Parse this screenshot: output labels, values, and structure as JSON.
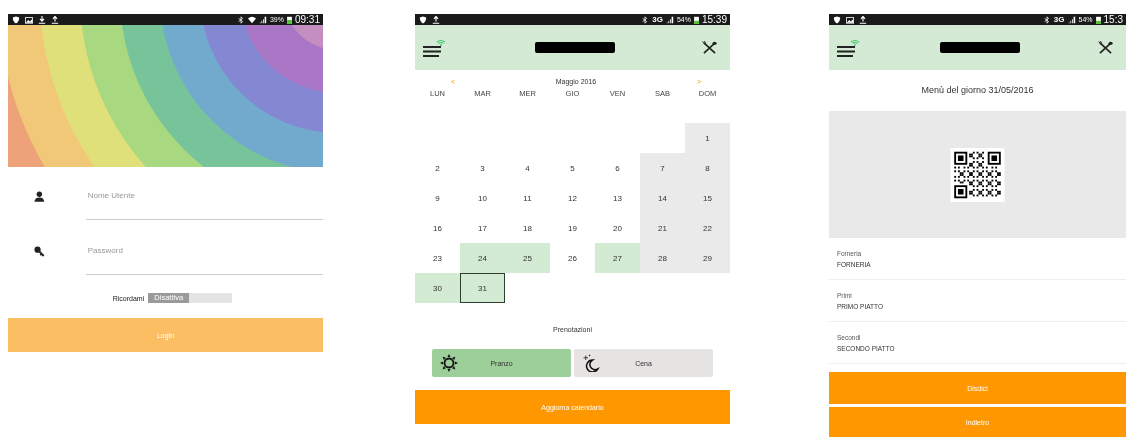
{
  "login_screen": {
    "status_bar": {
      "battery": "39%",
      "time": "09:31"
    },
    "username_field": {
      "placeholder": "Nome Utente"
    },
    "password_field": {
      "placeholder": "Password"
    },
    "remember": {
      "label": "Ricordami",
      "state_text": "Disattiva",
      "on": false
    },
    "login_button": "Login"
  },
  "calendar_screen": {
    "status_bar": {
      "network": "3G",
      "battery": "54%",
      "time": "15:39"
    },
    "prev": "<",
    "month": "Maggio 2016",
    "next": ">",
    "weekdays": [
      "LUN",
      "MAR",
      "MER",
      "GIO",
      "VEN",
      "SAB",
      "DOM"
    ],
    "days": [
      {
        "kind": "empty"
      },
      {
        "kind": "empty"
      },
      {
        "kind": "empty"
      },
      {
        "kind": "empty"
      },
      {
        "kind": "empty"
      },
      {
        "kind": "empty"
      },
      {
        "label": "1",
        "kind": "weekend",
        "selected": false
      },
      {
        "label": "2",
        "kind": "weekday",
        "selected": false
      },
      {
        "label": "3",
        "kind": "weekday",
        "selected": false
      },
      {
        "label": "4",
        "kind": "weekday",
        "selected": false
      },
      {
        "label": "5",
        "kind": "weekday",
        "selected": false
      },
      {
        "label": "6",
        "kind": "weekday",
        "selected": false
      },
      {
        "label": "7",
        "kind": "weekend",
        "selected": false
      },
      {
        "label": "8",
        "kind": "weekend",
        "selected": false
      },
      {
        "label": "9",
        "kind": "weekday",
        "selected": false
      },
      {
        "label": "10",
        "kind": "weekday",
        "selected": false
      },
      {
        "label": "11",
        "kind": "weekday",
        "selected": false
      },
      {
        "label": "12",
        "kind": "weekday",
        "selected": false
      },
      {
        "label": "13",
        "kind": "weekday",
        "selected": false
      },
      {
        "label": "14",
        "kind": "weekend",
        "selected": false
      },
      {
        "label": "15",
        "kind": "weekend",
        "selected": false
      },
      {
        "label": "16",
        "kind": "weekday",
        "selected": false
      },
      {
        "label": "17",
        "kind": "weekday",
        "selected": false
      },
      {
        "label": "18",
        "kind": "weekday",
        "selected": false
      },
      {
        "label": "19",
        "kind": "weekday",
        "selected": false
      },
      {
        "label": "20",
        "kind": "weekday",
        "selected": false
      },
      {
        "label": "21",
        "kind": "weekend",
        "selected": false
      },
      {
        "label": "22",
        "kind": "weekend",
        "selected": false
      },
      {
        "label": "23",
        "kind": "weekday",
        "selected": false
      },
      {
        "label": "24",
        "kind": "booked",
        "selected": false
      },
      {
        "label": "25",
        "kind": "booked",
        "selected": false
      },
      {
        "label": "26",
        "kind": "weekday",
        "selected": false
      },
      {
        "label": "27",
        "kind": "booked",
        "selected": false
      },
      {
        "label": "28",
        "kind": "weekend",
        "selected": false
      },
      {
        "label": "29",
        "kind": "weekend",
        "selected": false
      },
      {
        "label": "30",
        "kind": "booked",
        "selected": false
      },
      {
        "label": "31",
        "kind": "booked",
        "selected": true
      }
    ],
    "bookings_title": "Prenotazioni",
    "meals": [
      {
        "label": "Pranzo",
        "kind": "lunch",
        "selected": true
      },
      {
        "label": "Cena",
        "kind": "dinner",
        "selected": false
      }
    ],
    "update_button": "Aggiorna calendario"
  },
  "menu_screen": {
    "status_bar": {
      "network": "3G",
      "battery": "54%",
      "time": "15:3"
    },
    "title": "Menù del giorno 31/05/2016",
    "courses": [
      {
        "category": "Forneria",
        "dish": "FORNERIA"
      },
      {
        "category": "Primi",
        "dish": "PRIMO PIATTO"
      },
      {
        "category": "Secondi",
        "dish": "SECONDO PIATTO"
      }
    ],
    "cancel_button": "Disdici",
    "back_button": "Indietro"
  }
}
